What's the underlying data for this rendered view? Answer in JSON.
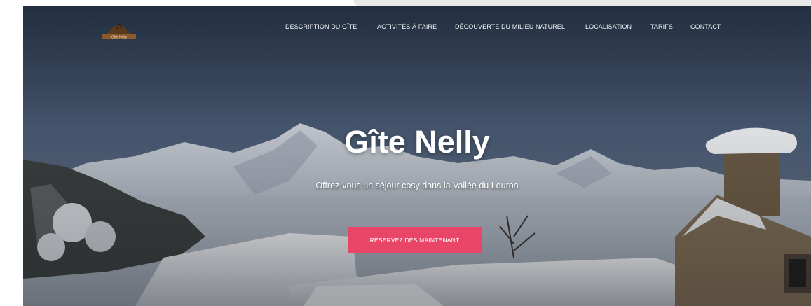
{
  "logo": {
    "icon": "chalet-logo-icon",
    "text": "Gîte Nelly"
  },
  "nav": {
    "items": [
      {
        "label": "DESCRIPTION DU GÎTE"
      },
      {
        "label": "ACTIVITÉS À FAIRE"
      },
      {
        "label": "DÉCOUVERTE DU MILIEU NATUREL"
      },
      {
        "label": "LOCALISATION"
      },
      {
        "label": "TARIFS"
      },
      {
        "label": "CONTACT"
      }
    ]
  },
  "hero": {
    "title": "Gîte Nelly",
    "subtitle": "Offrez-vous un séjour cosy dans la Vallée du Louron",
    "cta_label": "RÉSERVEZ DÈS MAINTENANT",
    "image": "snowy-mountain-village-photo"
  },
  "colors": {
    "accent": "#e94566",
    "sky": "#3a4a60",
    "logo_brown": "#7a4a24"
  }
}
